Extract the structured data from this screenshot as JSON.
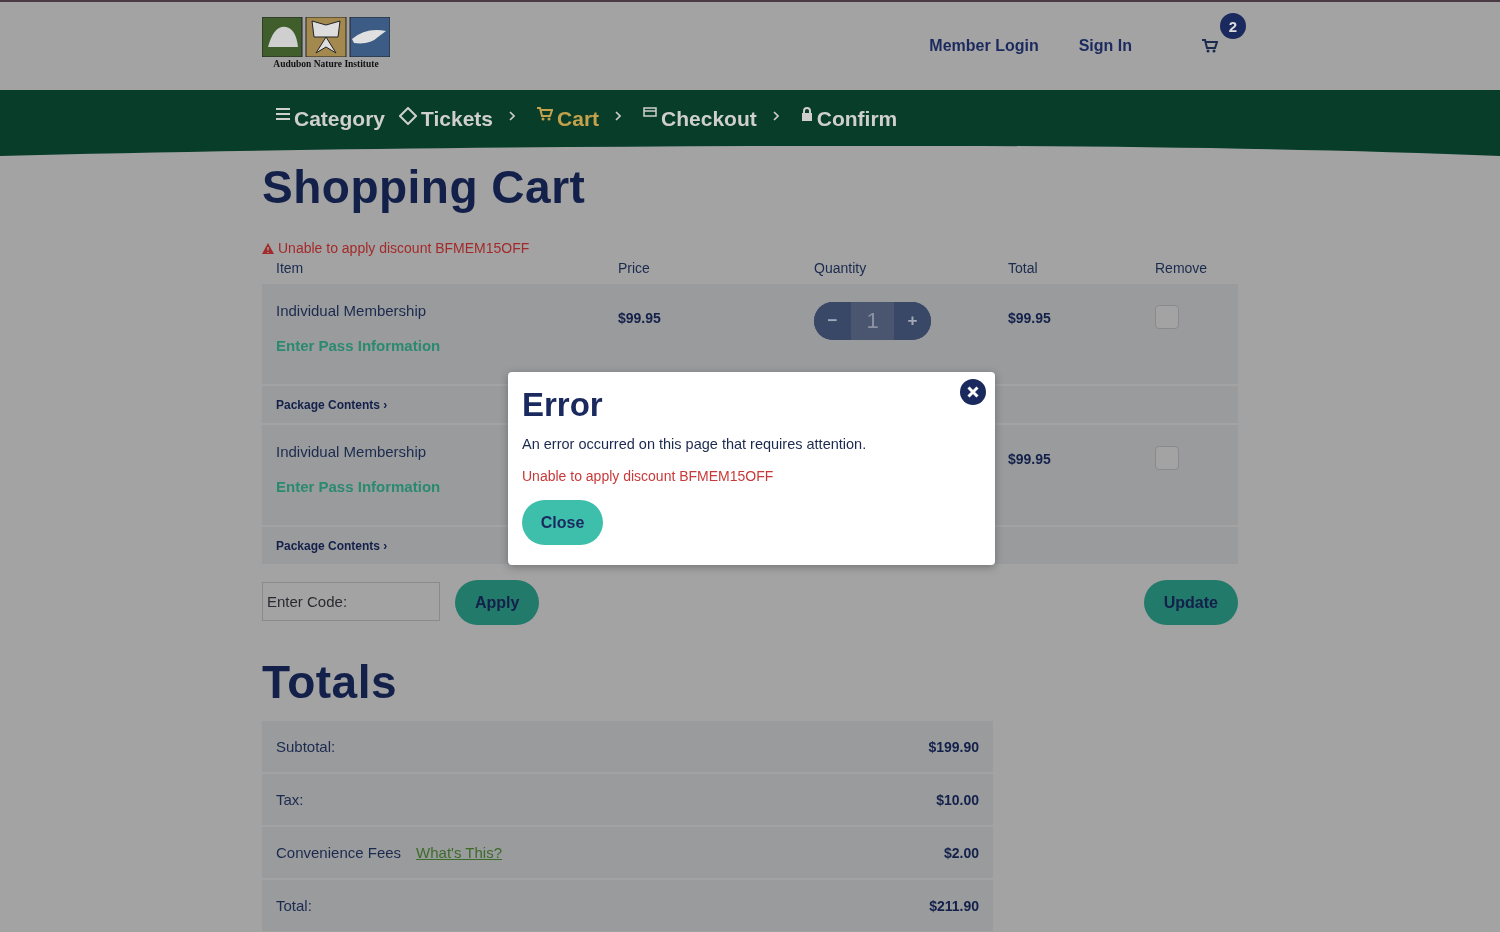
{
  "header": {
    "logo_text": "Audubon Nature Institute",
    "links": [
      "Member Login",
      "Sign In"
    ],
    "cart_count": "2"
  },
  "steps": [
    {
      "label": "Category",
      "selected": false
    },
    {
      "label": "Tickets",
      "selected": false
    },
    {
      "label": "Cart",
      "selected": true
    },
    {
      "label": "Checkout",
      "selected": false
    },
    {
      "label": "Confirm",
      "selected": false
    }
  ],
  "title": "Shopping Cart",
  "alert": "Unable to apply discount BFMEM15OFF",
  "table": {
    "columns": [
      "Item",
      "Price",
      "Quantity",
      "Total",
      "Remove"
    ],
    "rows": [
      {
        "name": "Individual Membership",
        "link": "Enter Pass Information",
        "price": "$99.95",
        "quantity": {
          "minus": "−",
          "value": "1",
          "plus": "+"
        },
        "total": "$99.95",
        "checked": false,
        "package": "Package Contents ›"
      },
      {
        "name": "Individual Membership",
        "link": "Enter Pass Information",
        "total": "$99.95",
        "checked": false,
        "package": "Package Contents ›"
      }
    ]
  },
  "code": {
    "placeholder": "Enter Code:",
    "apply": "Apply",
    "update": "Update"
  },
  "totals": {
    "title": "Totals",
    "rows": [
      {
        "label": "Subtotal:",
        "value": "$199.90"
      },
      {
        "label": "Tax:",
        "value": "$10.00"
      },
      {
        "label": "Convenience Fees",
        "link": "What's This?",
        "value": "$2.00"
      },
      {
        "label": "Total:",
        "value": "$211.90"
      }
    ]
  },
  "modal": {
    "title": "Error",
    "message": "An error occurred on this page that requires attention.",
    "error": "Unable to apply discount BFMEM15OFF",
    "button": "Close"
  }
}
